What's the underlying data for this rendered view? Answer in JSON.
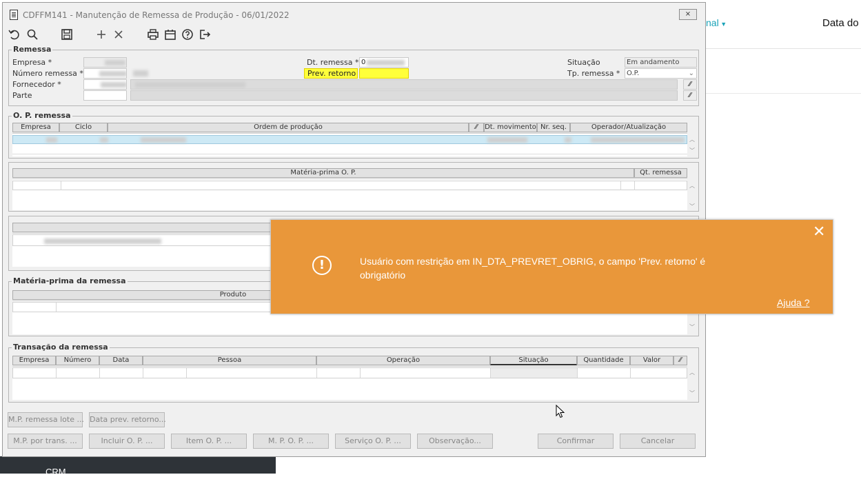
{
  "background": {
    "menu_label": "nal",
    "column_label": "Data do",
    "footer_text": "CRM"
  },
  "window": {
    "title": "CDFFM141 - Manutenção de Remessa de Produção - 06/01/2022",
    "close_label": "⨯"
  },
  "remessa": {
    "group_label": "Remessa",
    "empresa_label": "Empresa *",
    "numero_label": "Número remessa *",
    "fornecedor_label": "Fornecedor *",
    "parte_label": "Parte",
    "dt_remessa_label": "Dt. remessa *",
    "dt_remessa_value": "0",
    "prev_retorno_label": "Prev. retorno",
    "prev_retorno_value": "",
    "situacao_label": "Situação",
    "situacao_value": "Em andamento",
    "tp_remessa_label": "Tp. remessa *",
    "tp_remessa_value": "O.P."
  },
  "op_remessa": {
    "group_label": "O. P. remessa",
    "columns": [
      "Empresa",
      "Ciclo",
      "Ordem de produção",
      "Dt. movimento",
      "Nr. seq.",
      "Operador/Atualização"
    ]
  },
  "materia_op": {
    "columns": [
      "Matéria-prima O. P.",
      "Qt. remessa"
    ]
  },
  "materia_remessa": {
    "group_label": "Matéria-prima da remessa",
    "columns": [
      "Produto"
    ]
  },
  "transacao": {
    "group_label": "Transação da remessa",
    "columns": [
      "Empresa",
      "Número",
      "Data",
      "Pessoa",
      "Operação",
      "Situação",
      "Quantidade",
      "Valor"
    ]
  },
  "buttons": {
    "mp_remessa_lote": "M.P. remessa lote ...",
    "data_prev_retorno": "Data prev. retorno...",
    "mp_por_trans": "M.P. por trans. ...",
    "incluir_op": "Incluir O. P. ...",
    "item_op": "Item O. P. ...",
    "mpop": "M. P. O. P. ...",
    "servico_op": "Serviço O. P. ...",
    "observacao": "Observação...",
    "confirmar": "Confirmar",
    "cancelar": "Cancelar"
  },
  "toast": {
    "message": "Usuário com restrição em IN_DTA_PREVRET_OBRIG, o campo 'Prev. retorno' é obrigatório",
    "help_link": "Ajuda ?",
    "close": "✕",
    "icon": "exclamation-circle-icon",
    "color": "#e9973a"
  }
}
